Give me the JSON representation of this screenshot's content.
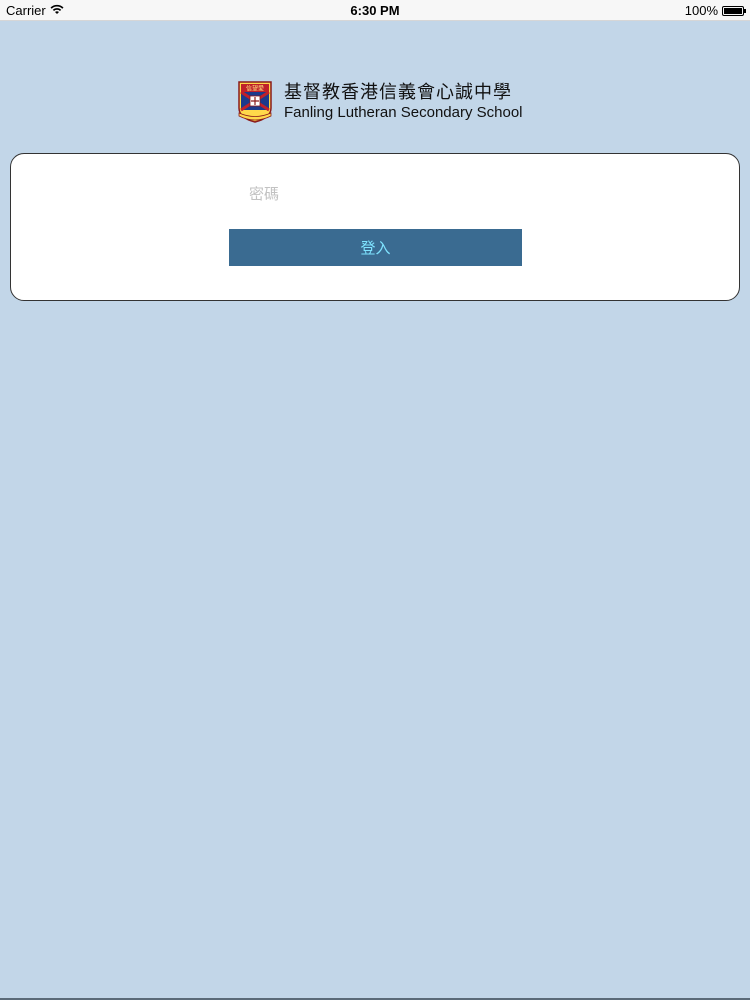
{
  "status_bar": {
    "carrier": "Carrier",
    "wifi_icon": "wifi-icon",
    "time": "6:30 PM",
    "battery_percent": "100%",
    "battery_icon": "battery-icon"
  },
  "header": {
    "crest_icon": "school-crest-icon",
    "school_name_zh": "基督教香港信義會心誠中學",
    "school_name_en": "Fanling Lutheran Secondary School"
  },
  "login": {
    "password_placeholder": "密碼",
    "password_value": "",
    "submit_label": "登入"
  },
  "colors": {
    "background": "#c2d6e8",
    "button": "#3a6b91",
    "button_text": "#7fe3ff"
  }
}
